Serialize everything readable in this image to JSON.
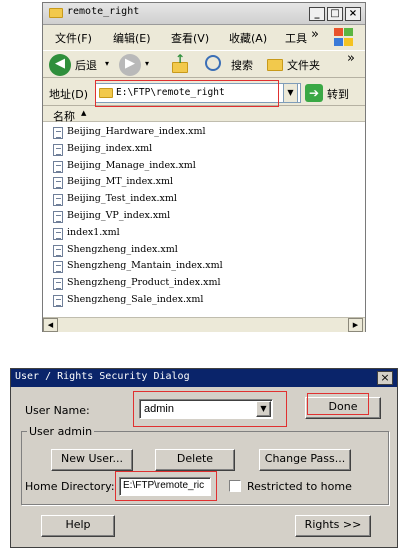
{
  "explorer": {
    "title": "remote_right",
    "title_buttons": [
      "_",
      "□",
      "×"
    ],
    "menu": [
      "文件(F)",
      "编辑(E)",
      "查看(V)",
      "收藏(A)",
      "工具"
    ],
    "menu_overflow": "»",
    "toolbar": {
      "back_label": "后退",
      "search_label": "搜索",
      "folders_label": "文件夹",
      "overflow": "»"
    },
    "address": {
      "label": "地址(D)",
      "value": "E:\\FTP\\remote_right",
      "go_label": "转到"
    },
    "column_header": "名称",
    "files": [
      "Beijing_Hardware_index.xml",
      "Beijing_index.xml",
      "Beijing_Manage_index.xml",
      "Beijing_MT_index.xml",
      "Beijing_Test_index.xml",
      "Beijing_VP_index.xml",
      "index1.xml",
      "Shengzheng_index.xml",
      "Shengzheng_Mantain_index.xml",
      "Shengzheng_Product_index.xml",
      "Shengzheng_Sale_index.xml"
    ]
  },
  "dialog": {
    "title": "User / Rights Security Dialog",
    "close": "×",
    "user_name_label": "User Name:",
    "user_name_value": "admin",
    "done_label": "Done",
    "group_label": "User admin",
    "new_user_label": "New User...",
    "delete_label": "Delete",
    "change_pass_label": "Change Pass...",
    "home_dir_label": "Home Directory:",
    "home_dir_value": "E:\\FTP\\remote_ric",
    "restricted_label": "Restricted to home",
    "help_label": "Help",
    "rights_label": "Rights >>"
  },
  "colors": {
    "highlight_box": "#e03030",
    "dialog_titlebar": "#0a246a",
    "dialog_face": "#d4d0c8",
    "explorer_face": "#ece9d8"
  }
}
